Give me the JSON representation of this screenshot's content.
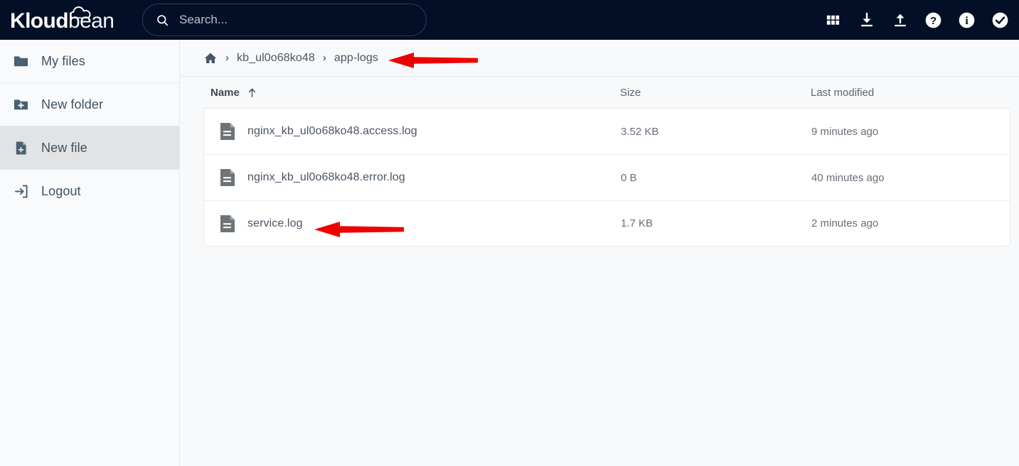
{
  "header": {
    "logo": {
      "bold": "Kloud",
      "light": "bean",
      "icon": "cloud-icon"
    },
    "search": {
      "placeholder": "Search...",
      "value": "",
      "icon": "search-icon"
    },
    "actions": [
      {
        "name": "apps-grid-icon",
        "label": "Apps"
      },
      {
        "name": "download-icon",
        "label": "Download"
      },
      {
        "name": "upload-icon",
        "label": "Upload"
      },
      {
        "name": "help-icon",
        "label": "Help"
      },
      {
        "name": "info-icon",
        "label": "Info"
      },
      {
        "name": "check-circle-icon",
        "label": "Status"
      }
    ]
  },
  "sidebar": {
    "items": [
      {
        "label": "My files",
        "icon": "folder-icon",
        "active": false
      },
      {
        "label": "New folder",
        "icon": "folder-plus-icon",
        "active": false
      },
      {
        "label": "New file",
        "icon": "file-plus-icon",
        "active": true
      },
      {
        "label": "Logout",
        "icon": "logout-icon",
        "active": false
      }
    ]
  },
  "breadcrumb": {
    "home_icon": "home-icon",
    "separator": "›",
    "items": [
      {
        "label": "kb_ul0o68ko48"
      },
      {
        "label": "app-logs"
      }
    ]
  },
  "table": {
    "columns": {
      "name": "Name",
      "size": "Size",
      "modified": "Last modified"
    },
    "sort": {
      "column": "Name",
      "direction": "asc",
      "icon": "arrow-up-icon"
    },
    "rows": [
      {
        "icon": "file-icon",
        "name": "nginx_kb_ul0o68ko48.access.log",
        "size": "3.52 KB",
        "modified": "9 minutes ago"
      },
      {
        "icon": "file-icon",
        "name": "nginx_kb_ul0o68ko48.error.log",
        "size": "0 B",
        "modified": "40 minutes ago"
      },
      {
        "icon": "file-icon",
        "name": "service.log",
        "size": "1.7 KB",
        "modified": "2 minutes ago"
      }
    ]
  },
  "annotations": {
    "color": "#ee0000",
    "arrows": [
      {
        "name": "arrow-pointing-to-app-logs",
        "target": "app-logs"
      },
      {
        "name": "arrow-pointing-to-service-log",
        "target": "service.log"
      }
    ]
  },
  "colors": {
    "topbar_bg": "#020f26",
    "page_bg": "#f8f9fa",
    "sidebar_bg": "#f9fafb",
    "sidebar_active_bg": "#e2e3e4",
    "text_slate": "#3e5163",
    "annotation_red": "#ee0000"
  }
}
